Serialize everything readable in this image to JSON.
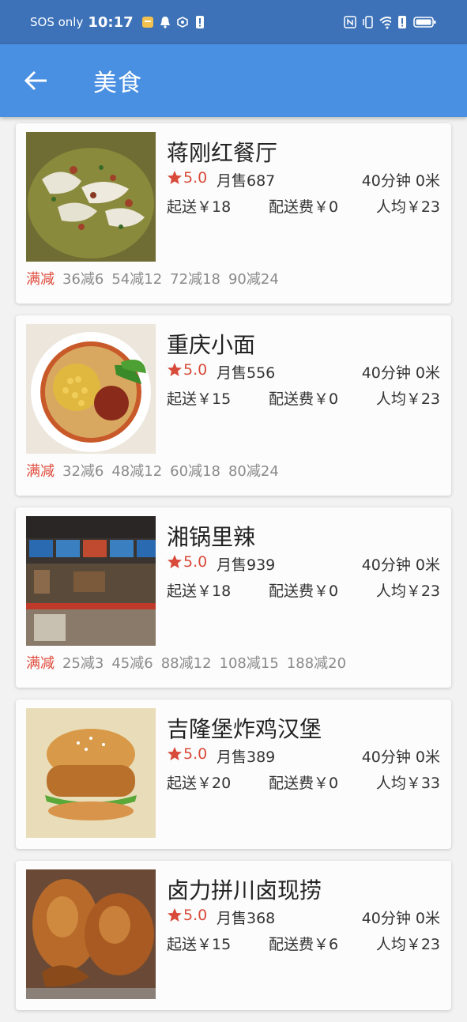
{
  "status_bar": {
    "carrier": "SOS only",
    "time": "10:17",
    "icons_left": [
      "notification-app-icon",
      "bell-icon",
      "vpn-icon",
      "alert-icon"
    ],
    "icons_right": [
      "nfc-icon",
      "vibrate-icon",
      "wifi-icon",
      "alert-icon",
      "battery-icon"
    ]
  },
  "app_bar": {
    "title": "美食",
    "back_icon": "arrow-left-icon"
  },
  "colors": {
    "status_bar": "#3d72b8",
    "app_bar": "#4a90e2",
    "accent_red": "#d84a3a"
  },
  "restaurants": [
    {
      "name": "蒋刚红餐厅",
      "rating": "5.0",
      "sales": "月售687",
      "distance": "40分钟  0米",
      "min_order": "起送￥18",
      "delivery_fee": "配送费￥0",
      "avg_price": "人均￥23",
      "promo_label": "满减",
      "promos": [
        "36减6",
        "54减12",
        "72减18",
        "90减24"
      ],
      "image": "pickled-fish-soup"
    },
    {
      "name": "重庆小面",
      "rating": "5.0",
      "sales": "月售556",
      "distance": "40分钟  0米",
      "min_order": "起送￥15",
      "delivery_fee": "配送费￥0",
      "avg_price": "人均￥23",
      "promo_label": "满减",
      "promos": [
        "32减6",
        "48减12",
        "60减18",
        "80减24"
      ],
      "image": "chongqing-noodles"
    },
    {
      "name": "湘锅里辣",
      "rating": "5.0",
      "sales": "月售939",
      "distance": "40分钟  0米",
      "min_order": "起送￥18",
      "delivery_fee": "配送费￥0",
      "avg_price": "人均￥23",
      "promo_label": "满减",
      "promos": [
        "25减3",
        "45减6",
        "88减12",
        "108减15",
        "188减20"
      ],
      "image": "restaurant-counter"
    },
    {
      "name": "吉隆堡炸鸡汉堡",
      "rating": "5.0",
      "sales": "月售389",
      "distance": "40分钟  0米",
      "min_order": "起送￥20",
      "delivery_fee": "配送费￥0",
      "avg_price": "人均￥33",
      "promo_label": "",
      "promos": [],
      "image": "fried-chicken-burger"
    },
    {
      "name": "卤力拼川卤现捞",
      "rating": "5.0",
      "sales": "月售368",
      "distance": "40分钟  0米",
      "min_order": "起送￥15",
      "delivery_fee": "配送费￥6",
      "avg_price": "人均￥23",
      "promo_label": "",
      "promos": [],
      "image": "braised-duck"
    }
  ]
}
